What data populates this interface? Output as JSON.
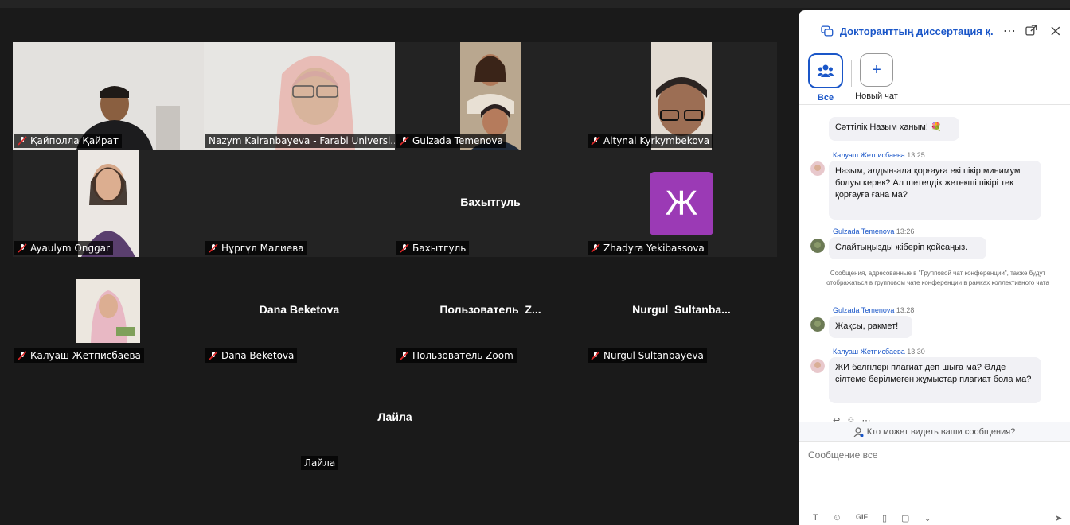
{
  "participants": [
    {
      "name": "Қайполла Қайрат",
      "display": "video",
      "muted": true
    },
    {
      "name": "Nazym Kairanbayeva - Farabi Universi...",
      "display": "video",
      "muted": false,
      "active": true
    },
    {
      "name": "Gulzada Temenova",
      "display": "video",
      "muted": true
    },
    {
      "name": "Altynai Kyrkymbekova",
      "display": "video",
      "muted": true
    },
    {
      "name": "Ayaulym Onggar",
      "display": "video",
      "muted": true
    },
    {
      "name": "Нұргүл Малиева",
      "display": "empty",
      "muted": true
    },
    {
      "name": "Бахытгуль",
      "display": "name",
      "center": "Бахытгуль",
      "muted": true
    },
    {
      "name": "Zhadyra Yekibassova",
      "display": "avatar",
      "letter": "Ж",
      "muted": true
    },
    {
      "name": "Калуаш Жетписбаева",
      "display": "video",
      "muted": true
    },
    {
      "name": "Dana Beketova",
      "display": "name",
      "center": "Dana Beketova",
      "muted": true
    },
    {
      "name": "Пользователь Zoom",
      "display": "name",
      "center": "Пользователь  Z...",
      "muted": true
    },
    {
      "name": "Nurgul Sultanbayeva",
      "display": "name",
      "center": "Nurgul  Sultanba...",
      "muted": true
    },
    {
      "name": "Лайла",
      "display": "name",
      "center": "Лайла",
      "muted": false
    }
  ],
  "chat": {
    "title": "Докторанттың диссертация қ...",
    "tabs": [
      {
        "label": "Все"
      },
      {
        "label": "Новый чат"
      }
    ],
    "messages": [
      {
        "text": "Сәттілік Назым ханым! 💐"
      },
      {
        "sender": "Калуаш Жетписбаева",
        "time": "13:25",
        "text": "Назым, алдын-ала қорғауға екі пікір минимум болуы керек? Ал шетелдік жетекші пікірі тек қорғауға ғана ма?"
      },
      {
        "sender": "Gulzada Temenova",
        "time": "13:26",
        "text": "Слайтыңызды жіберіп қойсаңыз."
      },
      {
        "sender": "Gulzada Temenova",
        "time": "13:28",
        "text": "Жақсы, рақмет!"
      },
      {
        "sender": "Калуаш Жетписбаева",
        "time": "13:30",
        "text": "ЖИ белгілері плагиат деп шыға ма? Әлде сілтеме берілмеген жұмыстар плагиат бола ма?"
      }
    ],
    "system_note": "Сообщения, адресованные в \"Групповой чат конференции\", также будут отображаться в групповом чате конференции в рамках коллективного чата",
    "who_can_see": "Кто может видеть ваши сообщения?",
    "compose_placeholder": "Сообщение все",
    "toolbar": [
      "T",
      "☺",
      "GIF",
      "▯",
      "▢",
      "⌄"
    ]
  }
}
